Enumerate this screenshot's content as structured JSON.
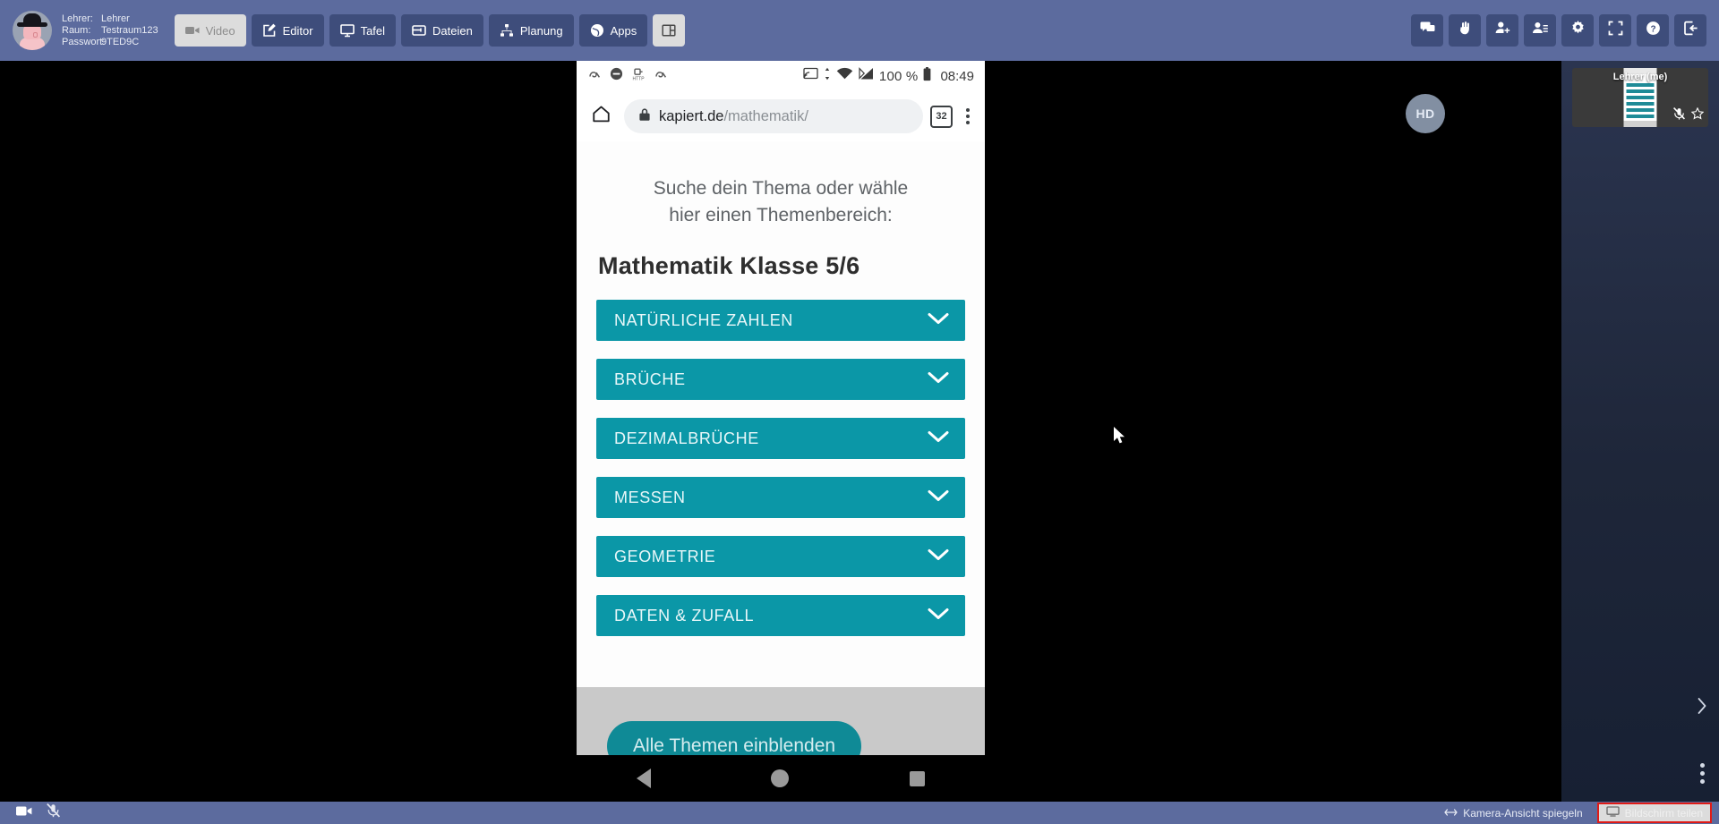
{
  "header": {
    "avatar_name": "user-avatar",
    "session": {
      "role_label": "Lehrer:",
      "role_value": "Lehrer",
      "room_label": "Raum:",
      "room_value": "Testraum123",
      "password_label": "Passwort:",
      "password_value": "9TED9C"
    },
    "nav_buttons": [
      {
        "label": "Video",
        "icon": "video-camera-icon",
        "active": true
      },
      {
        "label": "Editor",
        "icon": "pencil-square-icon",
        "active": false
      },
      {
        "label": "Tafel",
        "icon": "whiteboard-icon",
        "active": false
      },
      {
        "label": "Dateien",
        "icon": "folder-icon",
        "active": false
      },
      {
        "label": "Planung",
        "icon": "sitemap-icon",
        "active": false
      },
      {
        "label": "Apps",
        "icon": "globe-icon",
        "active": false
      },
      {
        "label": "",
        "icon": "layout-panel-icon",
        "active": true
      }
    ],
    "right_icons": [
      {
        "name": "chat-icon"
      },
      {
        "name": "raise-hand-icon"
      },
      {
        "name": "add-user-icon"
      },
      {
        "name": "user-list-icon"
      },
      {
        "name": "gear-icon"
      },
      {
        "name": "fullscreen-icon"
      },
      {
        "name": "help-icon"
      },
      {
        "name": "logout-icon"
      }
    ]
  },
  "stage": {
    "hd_badge": "HD",
    "shared_screen": {
      "phone_status_bar": {
        "battery_percent": "100 %",
        "clock": "08:49",
        "left_icons": [
          "avira-icon",
          "block-icon",
          "http-icon",
          "avira-icon"
        ],
        "right_icons": [
          "cast-icon",
          "data-transfer-icon",
          "wifi-icon",
          "signal-icon",
          "battery-icon"
        ]
      },
      "browser": {
        "home_icon": "home-icon",
        "lock_icon": "lock-icon",
        "url_host": "kapiert.de",
        "url_path": "/mathematik/",
        "tab_count": "32",
        "menu_icon": "kebab-menu-icon"
      },
      "page": {
        "lead_line1": "Suche dein Thema oder wähle",
        "lead_line2": "hier einen Themenbereich:",
        "subject_title": "Mathematik Klasse 5/6",
        "accent_color": "#0b97a7",
        "topics": [
          {
            "label": "NATÜRLICHE ZAHLEN",
            "chevron": "chevron-down-icon"
          },
          {
            "label": "BRÜCHE",
            "chevron": "chevron-down-icon"
          },
          {
            "label": "DEZIMALBRÜCHE",
            "chevron": "chevron-down-icon"
          },
          {
            "label": "MESSEN",
            "chevron": "chevron-down-icon"
          },
          {
            "label": "GEOMETRIE",
            "chevron": "chevron-down-icon"
          },
          {
            "label": "DATEN & ZUFALL",
            "chevron": "chevron-down-icon"
          }
        ],
        "show_all_button": "Alle Themen einblenden"
      },
      "android_nav": {
        "back": "back-triangle-icon",
        "home": "home-circle-icon",
        "recents": "recents-square-icon"
      }
    }
  },
  "right_panel": {
    "participants": [
      {
        "name": "Lehrer (me)",
        "mic_icon": "microphone-muted-icon",
        "star_icon": "star-outline-icon"
      }
    ],
    "collapse_icon": "chevron-right-icon",
    "overflow_icon": "kebab-menu-icon"
  },
  "bottom_bar": {
    "left_controls": [
      {
        "name": "camera-toggle",
        "icon": "video-camera-icon"
      },
      {
        "name": "microphone-toggle",
        "icon": "microphone-muted-icon"
      }
    ],
    "mirror_camera": {
      "label": "Kamera-Ansicht spiegeln",
      "icon": "mirror-arrows-icon"
    },
    "share_screen": {
      "label": "Bildschirm teilen",
      "icon": "monitor-icon",
      "highlight_color": "#e01b17"
    }
  }
}
